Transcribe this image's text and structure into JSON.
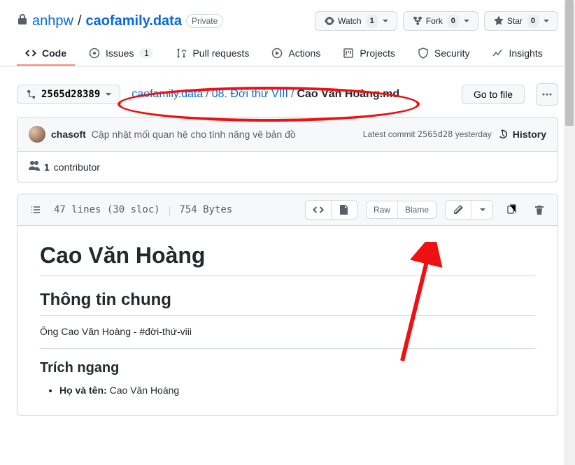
{
  "repo": {
    "owner": "anhpw",
    "name": "caofamily.data",
    "visibility": "Private"
  },
  "header_actions": {
    "watch": {
      "label": "Watch",
      "count": "1"
    },
    "fork": {
      "label": "Fork",
      "count": "0"
    },
    "star": {
      "label": "Star",
      "count": "0"
    }
  },
  "tabs": {
    "code": "Code",
    "issues": {
      "label": "Issues",
      "count": "1"
    },
    "pulls": "Pull requests",
    "actions": "Actions",
    "projects": "Projects",
    "security": "Security",
    "insights": "Insights"
  },
  "branch_ref": "2565d28389",
  "breadcrumbs": {
    "root": "caofamily.data",
    "folder": "08. Đời thứ VIII",
    "file": "Cao Văn Hoàng.md"
  },
  "buttons": {
    "go_to_file": "Go to file",
    "more": "..."
  },
  "latest_commit": {
    "author": "chasoft",
    "message": "Cập nhật mối quan hệ cho tính năng vẽ bản đồ",
    "meta_prefix": "Latest commit",
    "sha": "2565d28",
    "when": "yesterday",
    "history": "History"
  },
  "contributors": {
    "count": "1",
    "label": "contributor"
  },
  "file_stats": {
    "lines": "47 lines (30 sloc)",
    "bytes": "754 Bytes"
  },
  "file_buttons": {
    "raw": "Raw",
    "blame": "Blame"
  },
  "content": {
    "h1": "Cao Văn Hoàng",
    "h2a": "Thông tin chung",
    "p1": "Ông Cao Văn Hoàng - #đời-thứ-viii",
    "h3": "Trích ngang",
    "li1_label": "Họ và tên:",
    "li1_value": "Cao Văn Hoàng"
  }
}
